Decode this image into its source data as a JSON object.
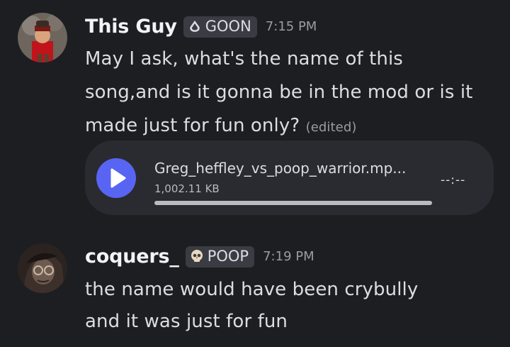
{
  "messages": [
    {
      "username": "This Guy",
      "tag": "GOON",
      "tag_icon": "drop-icon",
      "time": "7:15 PM",
      "lines": [
        "May I ask, what's the name of this",
        "song,and is it gonna be in the mod or is it",
        "made just for fun only?"
      ],
      "edited": "(edited)",
      "attachment": {
        "filename": "Greg_heffley_vs_poop_warrior.mp...",
        "filesize": "1,002.11 KB",
        "duration": "--:--",
        "play_icon": "play-icon"
      }
    },
    {
      "username": "coquers_",
      "tag": "POOP",
      "tag_icon": "skull-icon",
      "time": "7:19 PM",
      "lines": [
        "the name would have been crybully",
        "and it was just for fun"
      ]
    }
  ],
  "colors": {
    "background": "#1d1e22",
    "attachment_bg": "#2a2b31",
    "play_button": "#5865f2",
    "tag_bg": "#3b3c43",
    "muted_text": "#9b9ca3"
  }
}
